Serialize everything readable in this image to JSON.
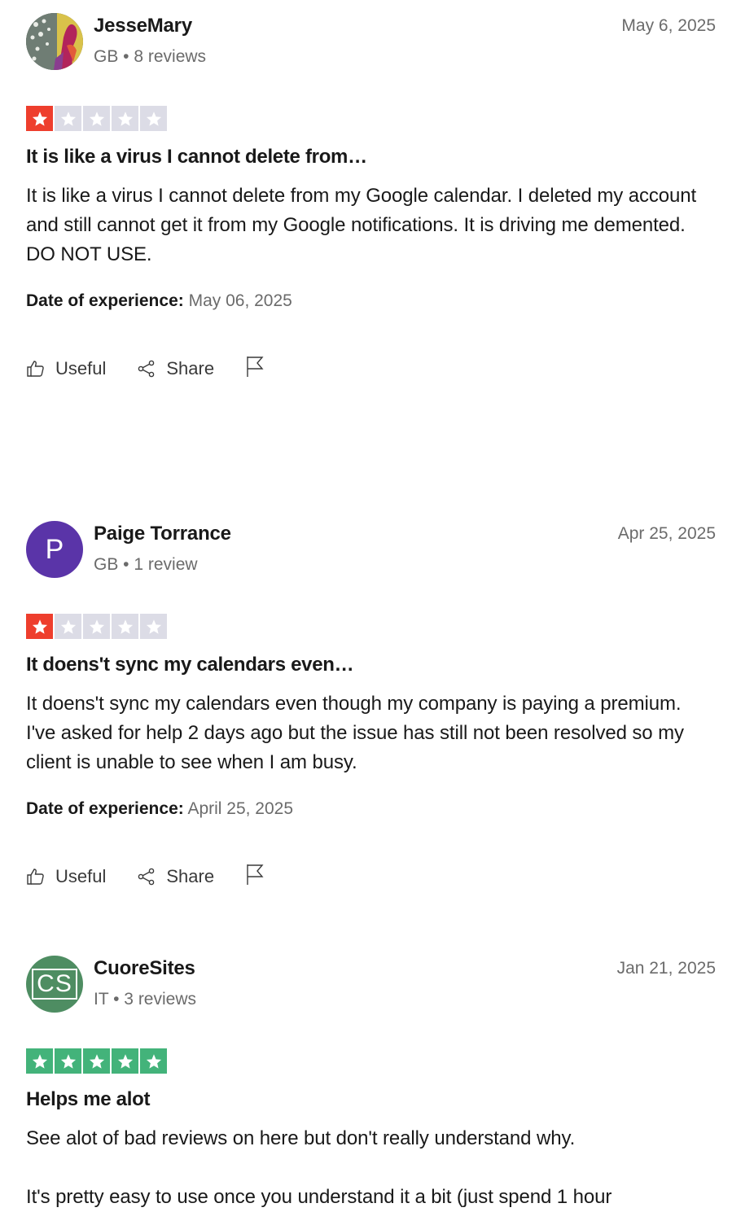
{
  "reviews": [
    {
      "name": "JesseMary",
      "meta": "GB • 8 reviews",
      "date": "May 6, 2025",
      "rating": 1,
      "star_color": "#ee3e2d",
      "title": "It is like a virus I cannot delete from…",
      "body": [
        "It is like a virus I cannot delete from my Google calendar. I deleted my account and still cannot get it from my Google notifications. It is driving me demented. DO NOT USE."
      ],
      "doe_label": "Date of experience:",
      "doe_value": "May 06, 2025"
    },
    {
      "name": "Paige Torrance",
      "avatar_letter": "P",
      "avatar_color": "#5a34a8",
      "meta": "GB • 1 review",
      "date": "Apr 25, 2025",
      "rating": 1,
      "star_color": "#ee3e2d",
      "title": "It doens't sync my calendars even…",
      "body": [
        "It doens't sync my calendars even though my company is paying a premium. I've asked for help 2 days ago but the issue has still not been resolved so my client is unable to see when I am busy."
      ],
      "doe_label": "Date of experience:",
      "doe_value": "April 25, 2025"
    },
    {
      "name": "CuoreSites",
      "avatar_letter": "CS",
      "avatar_color": "#4e8d62",
      "meta": "IT • 3 reviews",
      "date": "Jan 21, 2025",
      "rating": 5,
      "star_color": "#43b37a",
      "title": "Helps me alot",
      "body": [
        "See alot of bad reviews on here but don't really understand why.",
        "It's pretty easy to use once you understand it a bit (just spend 1 hour"
      ]
    }
  ],
  "actions": {
    "useful_label": "Useful",
    "share_label": "Share"
  },
  "icons": {
    "useful": "thumbs-up-icon",
    "share": "share-icon",
    "flag": "flag-icon"
  },
  "colors": {
    "star_empty": "#dcdce6"
  }
}
